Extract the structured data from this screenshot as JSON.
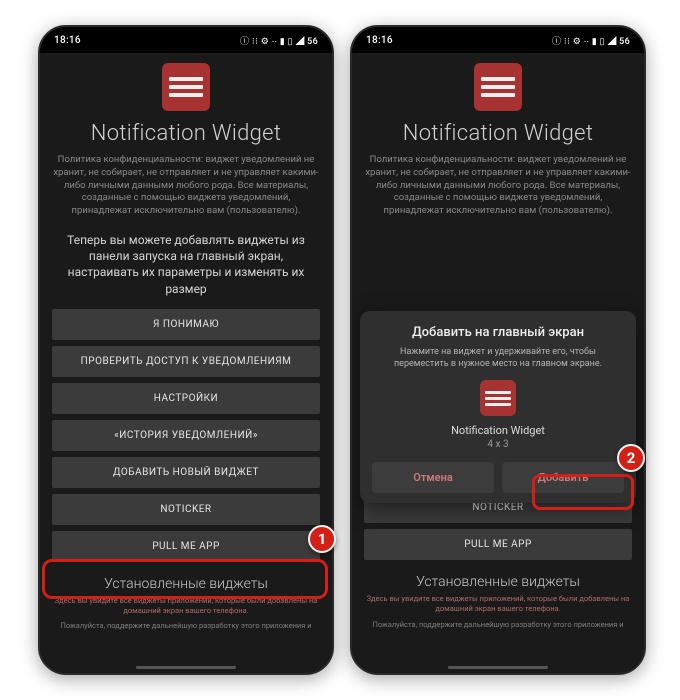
{
  "statusbar": {
    "time": "18:16",
    "right_glyphs": "ⓘ ⁝⁝ ⚙ ∙∙ ▮ ▯ ◢ 56"
  },
  "common": {
    "app_title": "Notification Widget",
    "policy": "Политика конфиденциальности: виджет уведомлений не хранит, не собирает, не отправляет и не управляет какими-либо личными данными любого рода. Все материалы, созданные с помощью виджета уведомлений, принадлежат исключительно вам (пользователю).",
    "hint": "Теперь вы можете добавлять виджеты из панели запуска на главный экран, настраивать их параметры и изменять их размер",
    "buttons": [
      "Я ПОНИМАЮ",
      "ПРОВЕРИТЬ ДОСТУП К УВЕДОМЛЕНИЯМ",
      "НАСТРОЙКИ",
      "«ИСТОРИЯ УВЕДОМЛЕНИЙ»",
      "ДОБАВИТЬ НОВЫЙ ВИДЖЕТ",
      "NOTICKER",
      "PULL ME APP"
    ],
    "installed_title": "Установленные виджеты",
    "footnote": "Здесь вы увидите все виджеты приложений, которые были добавлены на домашний экран вашего телефона.",
    "footnote2": "Пожалуйста, поддержите дальнейшую разработку этого приложения и"
  },
  "dialog": {
    "title": "Добавить на главный экран",
    "sub": "Нажмите на виджет и удерживайте его, чтобы переместить в нужное место на главном экране.",
    "widget_name": "Notification Widget",
    "widget_size": "4 x 3",
    "cancel": "Отмена",
    "add": "Добавить"
  },
  "badges": {
    "one": "1",
    "two": "2"
  }
}
